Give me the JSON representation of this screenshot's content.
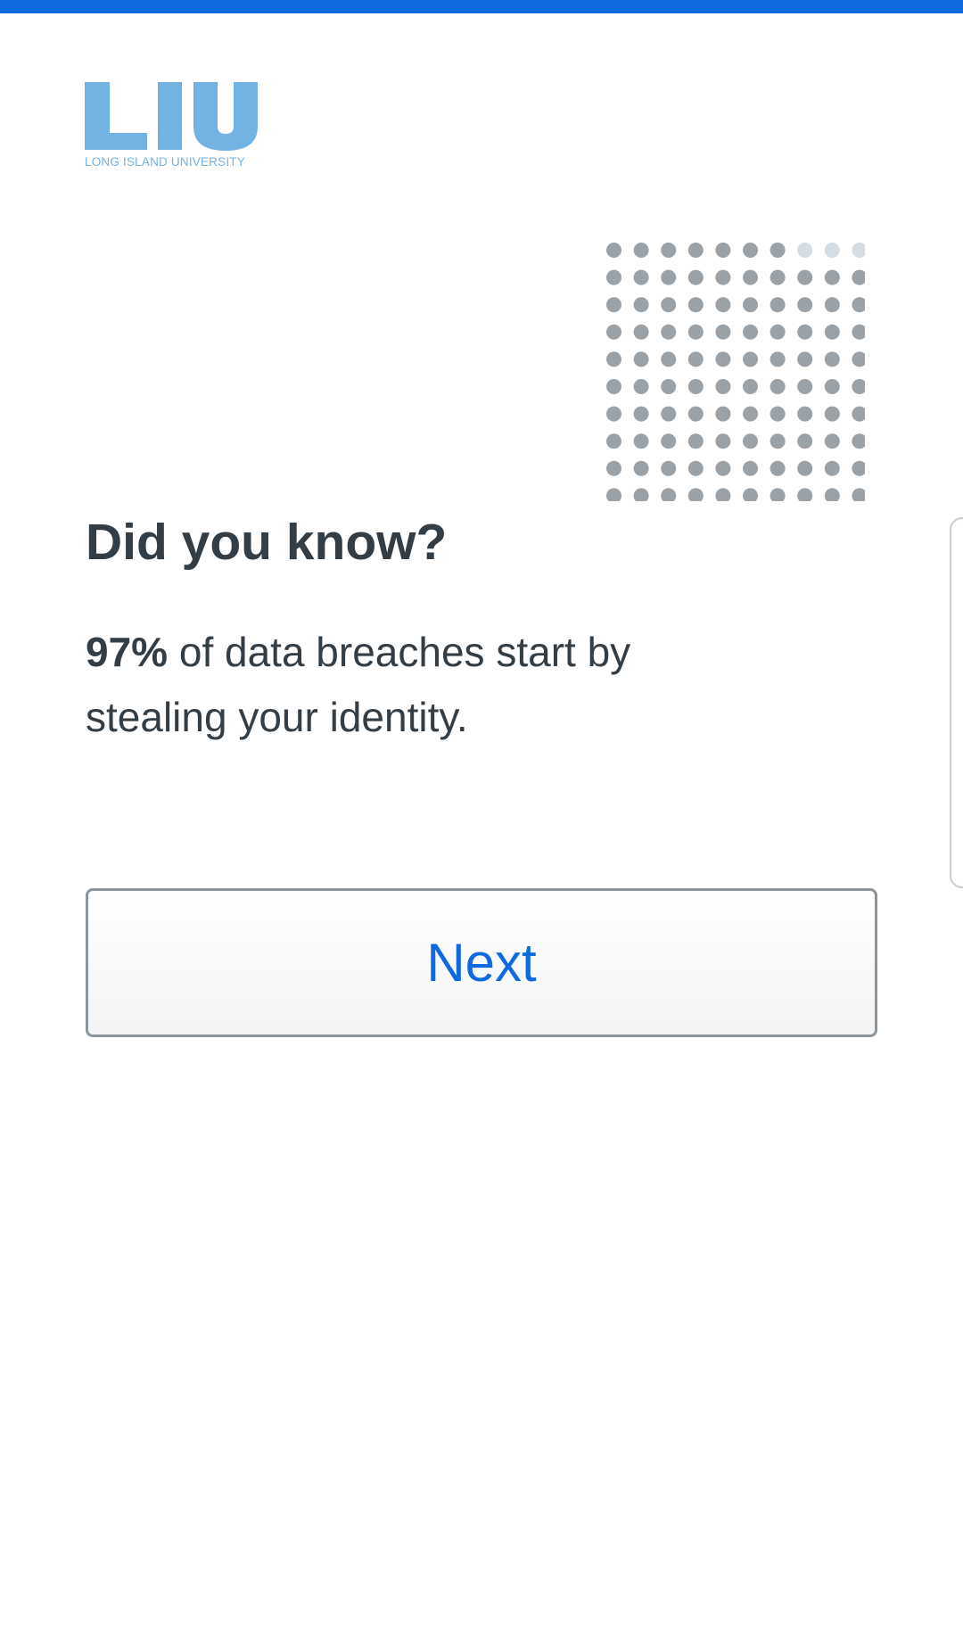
{
  "brand": {
    "logo_letters": "LIU",
    "logo_subtitle": "LONG ISLAND UNIVERSITY",
    "logo_color": "#72b3e3"
  },
  "accent_color": "#0f6adf",
  "decoration": {
    "icon": "dot-grid-icon",
    "dot_color": "#9aa1a7",
    "dot_faded_color": "#d4dde3"
  },
  "content": {
    "title": "Did you know?",
    "fact_stat": "97%",
    "fact_text": " of data breaches start by stealing your identity."
  },
  "actions": {
    "next_label": "Next"
  }
}
